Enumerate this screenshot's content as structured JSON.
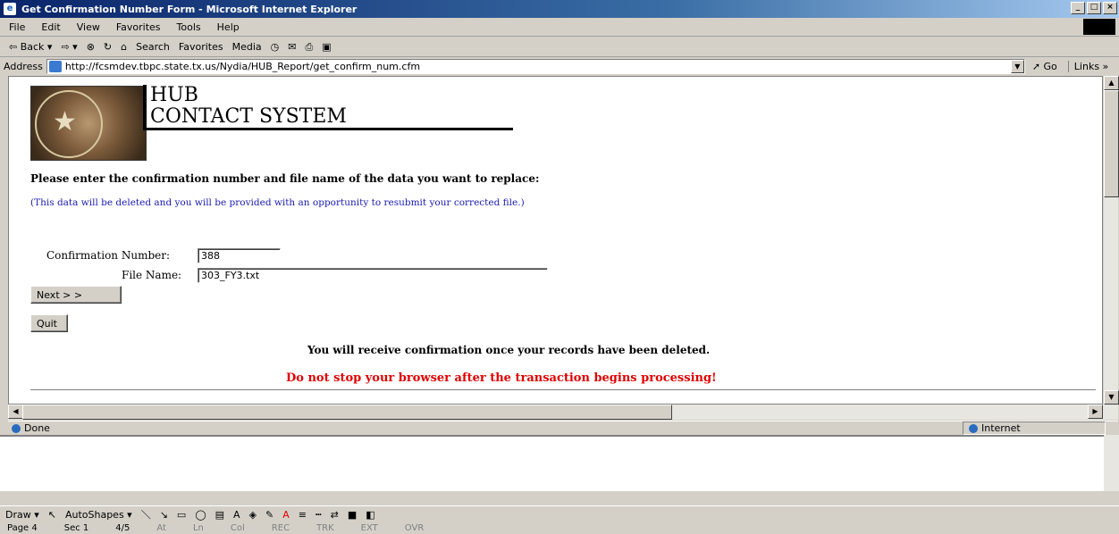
{
  "window": {
    "title": "Get Confirmation Number Form - Microsoft Internet Explorer"
  },
  "menu": [
    "File",
    "Edit",
    "View",
    "Favorites",
    "Tools",
    "Help"
  ],
  "toolbar": {
    "back": "⇦ Back ▾",
    "forward": "⇨ ▾",
    "search": "Search",
    "favorites": "Favorites",
    "media": "Media"
  },
  "address": {
    "label": "Address",
    "url": "http://fcsmdev.tbpc.state.tx.us/Nydia/HUB_Report/get_confirm_num.cfm",
    "go": "Go",
    "links": "Links »"
  },
  "page": {
    "title_line1": "HUB",
    "title_line2": "CONTACT SYSTEM",
    "instruction": "Please enter the confirmation number and file name of the data you want to replace:",
    "note": "(This data will be deleted and you will be provided with an opportunity to resubmit your corrected file.)",
    "confirmation_label": "Confirmation Number:",
    "confirmation_value": "388",
    "filename_label": "File Name:",
    "filename_value": "303_FY3.txt",
    "next_label": "Next > >",
    "quit_label": "Quit",
    "message": "You will receive confirmation once your records have been deleted.",
    "warning": "Do not stop your browser after the transaction begins processing!"
  },
  "status": {
    "text": "Done",
    "zone": "Internet"
  },
  "word": {
    "draw": "Draw ▾",
    "autoshapes": "AutoShapes ▾",
    "page": "Page 4",
    "sec": "Sec 1",
    "pages": "4/5",
    "at": "At",
    "ln": "Ln",
    "col": "Col",
    "rec": "REC",
    "trk": "TRK",
    "ext": "EXT",
    "ovr": "OVR"
  },
  "colors": {
    "note": "#1a1ab0",
    "warning": "#e00000",
    "titlebar": "#0a246a"
  }
}
